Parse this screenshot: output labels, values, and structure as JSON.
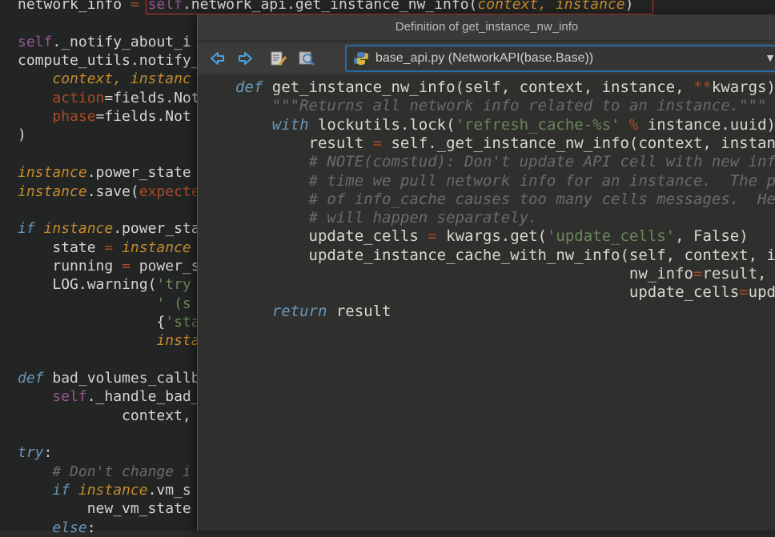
{
  "editor": {
    "lines": [
      {
        "indent": 0,
        "tokens": [
          {
            "t": "network_info ",
            "c": ""
          },
          {
            "t": "= ",
            "c": "kwarg"
          },
          {
            "t": "self",
            "c": "self"
          },
          {
            "t": ".network_api.get_instance_nw_info(",
            "c": ""
          },
          {
            "t": "context, instance",
            "c": "ital"
          },
          {
            "t": ")",
            "c": ""
          }
        ]
      },
      {
        "indent": 0,
        "tokens": []
      },
      {
        "indent": 0,
        "tokens": [
          {
            "t": "self",
            "c": "self"
          },
          {
            "t": "._notify_about_i",
            "c": ""
          }
        ]
      },
      {
        "indent": 0,
        "tokens": [
          {
            "t": "compute_utils.notify_",
            "c": ""
          }
        ]
      },
      {
        "indent": 4,
        "tokens": [
          {
            "t": "context, instanc",
            "c": "param"
          }
        ]
      },
      {
        "indent": 4,
        "tokens": [
          {
            "t": "action",
            "c": "kwarg"
          },
          {
            "t": "=fields.Not",
            "c": ""
          }
        ]
      },
      {
        "indent": 4,
        "tokens": [
          {
            "t": "phase",
            "c": "kwarg"
          },
          {
            "t": "=fields.Not",
            "c": ""
          }
        ]
      },
      {
        "indent": 0,
        "tokens": [
          {
            "t": ")",
            "c": ""
          }
        ]
      },
      {
        "indent": 0,
        "tokens": []
      },
      {
        "indent": 0,
        "tokens": [
          {
            "t": "instance",
            "c": "ital"
          },
          {
            "t": ".power_state",
            "c": ""
          }
        ]
      },
      {
        "indent": 0,
        "tokens": [
          {
            "t": "instance",
            "c": "ital"
          },
          {
            "t": ".save(",
            "c": ""
          },
          {
            "t": "expecte",
            "c": "kwarg"
          }
        ]
      },
      {
        "indent": 0,
        "tokens": []
      },
      {
        "indent": 0,
        "tokens": [
          {
            "t": "if ",
            "c": "kw"
          },
          {
            "t": "instance",
            "c": "ital"
          },
          {
            "t": ".power_sta",
            "c": ""
          }
        ]
      },
      {
        "indent": 4,
        "tokens": [
          {
            "t": "state ",
            "c": ""
          },
          {
            "t": "= ",
            "c": "kwarg"
          },
          {
            "t": "instance",
            "c": "ital"
          }
        ]
      },
      {
        "indent": 4,
        "tokens": [
          {
            "t": "running ",
            "c": ""
          },
          {
            "t": "= ",
            "c": "kwarg"
          },
          {
            "t": "power_s",
            "c": ""
          }
        ]
      },
      {
        "indent": 4,
        "tokens": [
          {
            "t": "LOG.warning(",
            "c": ""
          },
          {
            "t": "'try",
            "c": "str"
          }
        ]
      },
      {
        "indent": 16,
        "tokens": [
          {
            "t": "' (s",
            "c": "str"
          }
        ]
      },
      {
        "indent": 16,
        "tokens": [
          {
            "t": "{",
            "c": ""
          },
          {
            "t": "'sta",
            "c": "str"
          }
        ]
      },
      {
        "indent": 16,
        "tokens": [
          {
            "t": "insta",
            "c": "param"
          }
        ]
      },
      {
        "indent": 0,
        "tokens": []
      },
      {
        "indent": 0,
        "tokens": [
          {
            "t": "def ",
            "c": "kw"
          },
          {
            "t": "bad_volumes_callb",
            "c": ""
          }
        ]
      },
      {
        "indent": 4,
        "tokens": [
          {
            "t": "self",
            "c": "self"
          },
          {
            "t": "._handle_bad_",
            "c": ""
          }
        ]
      },
      {
        "indent": 12,
        "tokens": [
          {
            "t": "context,",
            "c": ""
          }
        ]
      },
      {
        "indent": 0,
        "tokens": []
      },
      {
        "indent": 0,
        "tokens": [
          {
            "t": "try",
            "c": "kw"
          },
          {
            "t": ":",
            "c": ""
          }
        ]
      },
      {
        "indent": 4,
        "tokens": [
          {
            "t": "# Don't change i",
            "c": "comment"
          }
        ]
      },
      {
        "indent": 4,
        "tokens": [
          {
            "t": "if ",
            "c": "kw"
          },
          {
            "t": "instance",
            "c": "ital"
          },
          {
            "t": ".vm_s",
            "c": ""
          }
        ]
      },
      {
        "indent": 8,
        "tokens": [
          {
            "t": "new_vm_state",
            "c": ""
          }
        ]
      },
      {
        "indent": 4,
        "tokens": [
          {
            "t": "else",
            "c": "kw"
          },
          {
            "t": ":",
            "c": ""
          }
        ]
      }
    ]
  },
  "popup": {
    "title": "Definition of get_instance_nw_info",
    "toolbar": {
      "back_icon": "arrow-left-icon",
      "forward_icon": "arrow-right-icon",
      "edit_icon": "edit-source-icon",
      "find_icon": "find-usages-icon"
    },
    "file_selector": {
      "label": "base_api.py (NetworkAPI(base.Base))",
      "icon": "python-file-icon"
    },
    "lines": [
      {
        "indent": 0,
        "tokens": [
          {
            "t": "def ",
            "c": "kw"
          },
          {
            "t": "get_instance_nw_info(self, context, instance, ",
            "c": ""
          },
          {
            "t": "**",
            "c": "kwarg"
          },
          {
            "t": "kwargs):",
            "c": ""
          }
        ]
      },
      {
        "indent": 4,
        "tokens": [
          {
            "t": "\"\"\"Returns all network info related to an instance.\"\"\"",
            "c": "comment"
          }
        ]
      },
      {
        "indent": 4,
        "tokens": [
          {
            "t": "with ",
            "c": "kw"
          },
          {
            "t": "lockutils.lock(",
            "c": ""
          },
          {
            "t": "'refresh_cache-%s'",
            "c": "str"
          },
          {
            "t": " ",
            "c": ""
          },
          {
            "t": "%",
            "c": "kwarg"
          },
          {
            "t": " instance.uuid):",
            "c": ""
          }
        ]
      },
      {
        "indent": 8,
        "tokens": [
          {
            "t": "result ",
            "c": ""
          },
          {
            "t": "= ",
            "c": "kwarg"
          },
          {
            "t": "self._get_instance_nw_info(context, instance",
            "c": ""
          }
        ]
      },
      {
        "indent": 8,
        "tokens": [
          {
            "t": "# NOTE(comstud): Don't update API cell with new info_c",
            "c": "comment"
          }
        ]
      },
      {
        "indent": 8,
        "tokens": [
          {
            "t": "# time we pull network info for an instance.  The per",
            "c": "comment"
          }
        ]
      },
      {
        "indent": 8,
        "tokens": [
          {
            "t": "# of info_cache causes too many cells messages.  Heal",
            "c": "comment"
          }
        ]
      },
      {
        "indent": 8,
        "tokens": [
          {
            "t": "# will happen separately.",
            "c": "comment"
          }
        ]
      },
      {
        "indent": 8,
        "tokens": [
          {
            "t": "update_cells ",
            "c": ""
          },
          {
            "t": "= ",
            "c": "kwarg"
          },
          {
            "t": "kwargs.get(",
            "c": ""
          },
          {
            "t": "'update_cells'",
            "c": "str"
          },
          {
            "t": ", False)",
            "c": ""
          }
        ]
      },
      {
        "indent": 8,
        "tokens": [
          {
            "t": "update_instance_cache_with_nw_info(self, context, inst",
            "c": ""
          }
        ]
      },
      {
        "indent": 43,
        "tokens": [
          {
            "t": "nw_info",
            "c": ""
          },
          {
            "t": "=",
            "c": "kwarg"
          },
          {
            "t": "result,",
            "c": ""
          }
        ]
      },
      {
        "indent": 43,
        "tokens": [
          {
            "t": "update_cells",
            "c": ""
          },
          {
            "t": "=",
            "c": "kwarg"
          },
          {
            "t": "update",
            "c": ""
          }
        ]
      },
      {
        "indent": 4,
        "tokens": [
          {
            "t": "return ",
            "c": "kw"
          },
          {
            "t": "result",
            "c": ""
          }
        ]
      }
    ]
  }
}
